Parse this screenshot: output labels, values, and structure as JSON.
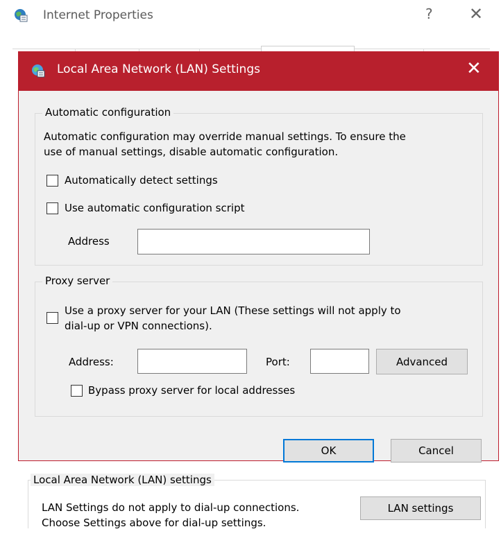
{
  "parent": {
    "title": "Internet Properties",
    "help_glyph": "?",
    "close_glyph": "✕",
    "lan_group_legend": "Local Area Network (LAN) settings",
    "lan_note_line1": "LAN Settings do not apply to dial-up connections.",
    "lan_note_line2": "Choose Settings above for dial-up settings.",
    "lan_settings_button": "LAN settings"
  },
  "dialog": {
    "title": "Local Area Network (LAN) Settings",
    "close_glyph": "✕",
    "accent_color": "#b8202d",
    "auto_config": {
      "legend": "Automatic configuration",
      "description_line1": "Automatic configuration may override manual settings.  To ensure the",
      "description_line2": "use of manual settings, disable automatic configuration.",
      "detect_label": "Automatically detect settings",
      "detect_checked": false,
      "script_label": "Use automatic configuration script",
      "script_checked": false,
      "address_label": "Address",
      "address_value": ""
    },
    "proxy": {
      "legend": "Proxy server",
      "use_proxy_line1": "Use a proxy server for your LAN (These settings will not apply to",
      "use_proxy_line2": "dial-up or VPN connections).",
      "use_proxy_checked": false,
      "address_label": "Address:",
      "address_value": "",
      "port_label": "Port:",
      "port_value": "",
      "advanced_button": "Advanced",
      "bypass_label": "Bypass proxy server for local addresses",
      "bypass_checked": false
    },
    "buttons": {
      "ok": "OK",
      "cancel": "Cancel"
    }
  }
}
